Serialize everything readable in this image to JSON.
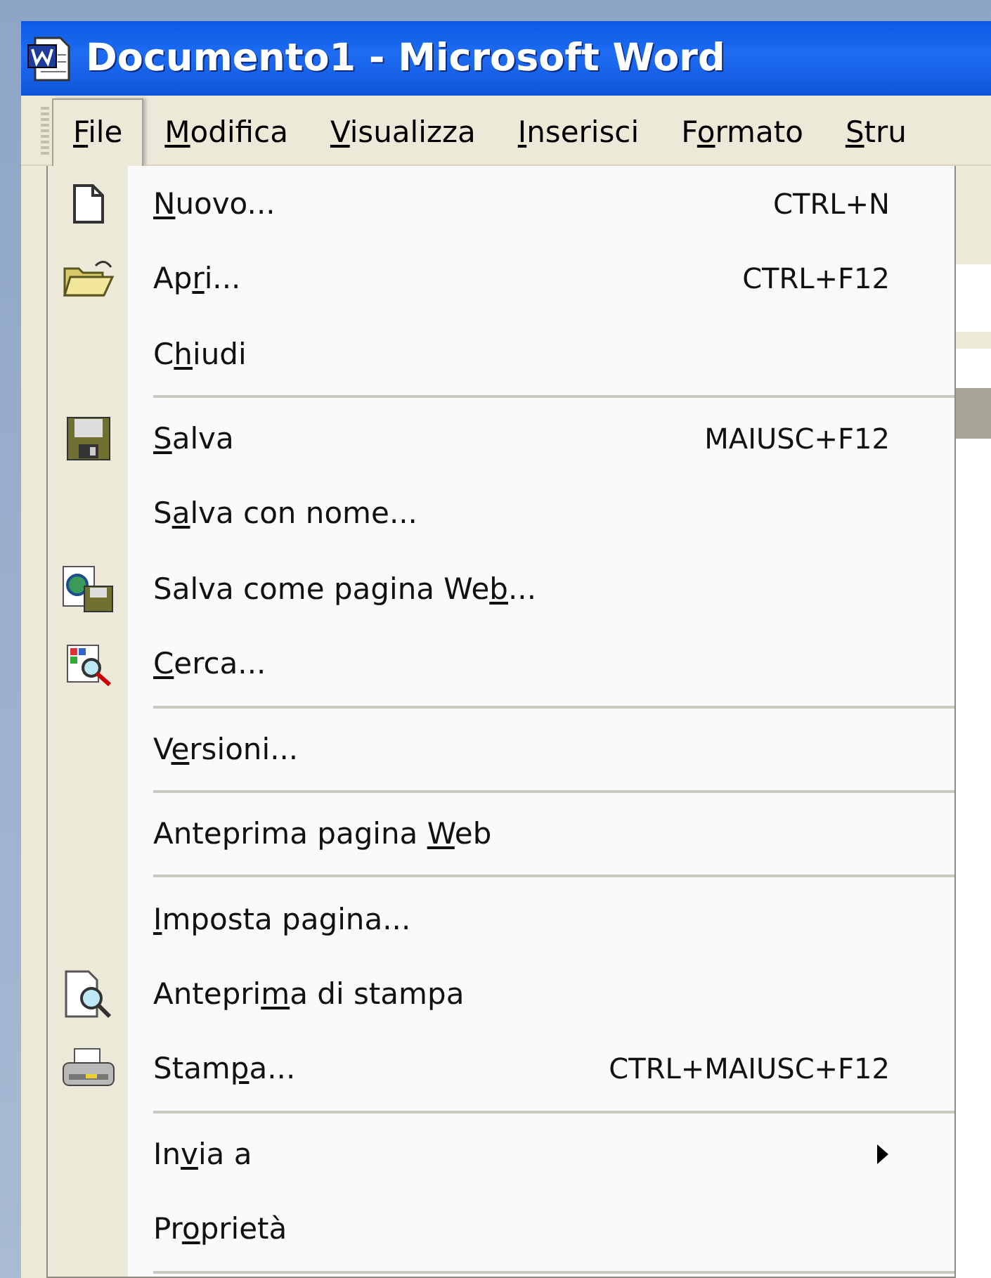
{
  "window": {
    "title": "Documento1 - Microsoft Word"
  },
  "menu_bar": [
    {
      "key": "F",
      "after": "ile",
      "selected": true
    },
    {
      "key": "M",
      "after": "odifica",
      "selected": false
    },
    {
      "key": "V",
      "after": "isualizza",
      "selected": false
    },
    {
      "key": "I",
      "after": "nserisci",
      "selected": false
    },
    {
      "before": "F",
      "key": "o",
      "after": "rmato",
      "selected": false
    },
    {
      "key": "S",
      "after": "tru",
      "selected": false
    }
  ],
  "file_menu": [
    {
      "kind": "item",
      "key": "N",
      "after": "uovo...",
      "shortcut": "CTRL+N"
    },
    {
      "kind": "item",
      "before": "Ap",
      "key": "r",
      "after": "i...",
      "shortcut": "CTRL+F12"
    },
    {
      "kind": "item",
      "before": "C",
      "key": "h",
      "after": "iudi"
    },
    {
      "kind": "separator"
    },
    {
      "kind": "item",
      "key": "S",
      "after": "alva",
      "shortcut": "MAIUSC+F12"
    },
    {
      "kind": "item",
      "before": "S",
      "key": "a",
      "after": "lva con nome..."
    },
    {
      "kind": "item",
      "before": "Salva come pagina We",
      "key": "b",
      "after": "..."
    },
    {
      "kind": "item",
      "key": "C",
      "after": "erca..."
    },
    {
      "kind": "separator"
    },
    {
      "kind": "item",
      "before": "V",
      "key": "e",
      "after": "rsioni..."
    },
    {
      "kind": "separator"
    },
    {
      "kind": "item",
      "before": "Anteprima pagina ",
      "key": "W",
      "after": "eb"
    },
    {
      "kind": "separator"
    },
    {
      "kind": "item",
      "key": "I",
      "after": "mposta pagina..."
    },
    {
      "kind": "item",
      "before": "Antepri",
      "key": "m",
      "after": "a di stampa"
    },
    {
      "kind": "item",
      "before": "Stam",
      "key": "p",
      "after": "a...",
      "shortcut": "CTRL+MAIUSC+F12"
    },
    {
      "kind": "separator"
    },
    {
      "kind": "item",
      "before": "In",
      "key": "v",
      "after": "ia a",
      "submenu": true
    },
    {
      "kind": "item",
      "before": "Pr",
      "key": "o",
      "after": "prietà"
    },
    {
      "kind": "separator"
    }
  ]
}
